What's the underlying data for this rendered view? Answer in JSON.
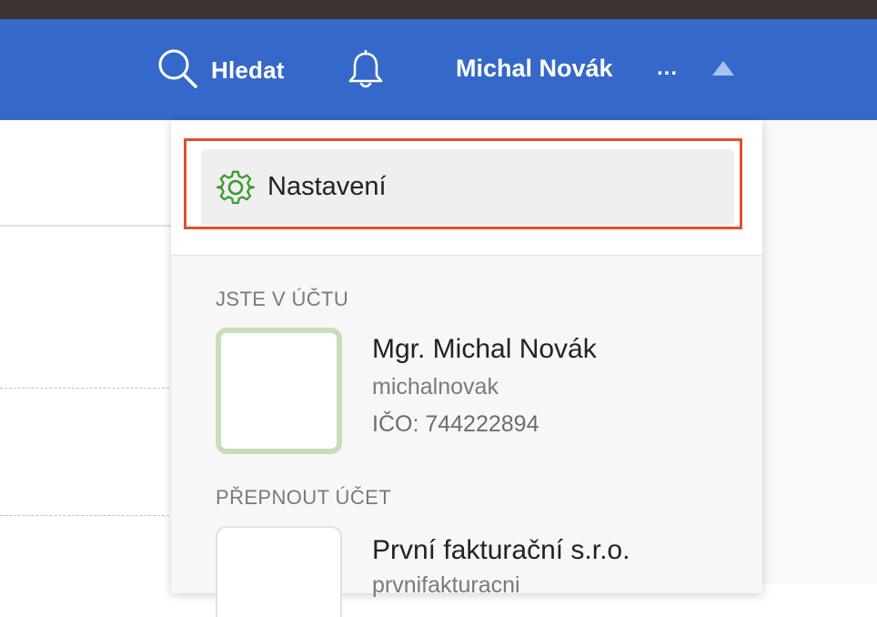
{
  "header": {
    "search_label": "Hledat",
    "user_name": "Michal Novák",
    "more_label": "...",
    "background_color": "#3568c8",
    "search_icon": "search-icon",
    "bell_icon": "bell-icon",
    "caret_icon": "caret-up-icon"
  },
  "dropdown": {
    "settings": {
      "label": "Nastavení",
      "icon": "gear-icon",
      "icon_color": "#3c9a2e",
      "highlight_color": "#e0512b"
    },
    "current_account": {
      "heading": "JSTE V ÚČTU",
      "name": "Mgr. Michal Novák",
      "username": "michalnovak",
      "ico": "IČO: 744222894",
      "avatar_border_color": "#c5dfba"
    },
    "switch_account": {
      "heading": "PŘEPNOUT ÚČET",
      "accounts": [
        {
          "name": "První fakturační s.r.o.",
          "username": "prvnifakturacni"
        }
      ]
    }
  }
}
